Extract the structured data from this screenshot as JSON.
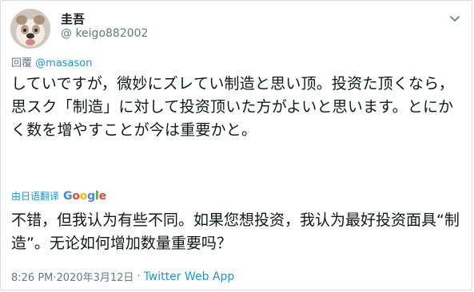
{
  "tweet": {
    "display_name": "圭吾",
    "handle": "@ keigo882002",
    "reply_prefix": "回覆",
    "reply_mention": "@masason",
    "text": "していですが，微妙にズレてい制造と思い顶。投资た顶くなら，思スク「制造」に対して投资顶いた方がよいと思います。とにかく数を增やすことが今は重要かと。",
    "translate_label": "由日语翻译",
    "translate_provider": "Google",
    "translated_text": "不错，但我认为有些不同。如果您想投资，我认为最好投资面具“制造”。无论如何增加数量重要吗？",
    "time": "8:26 PM·2020年3月12日",
    "separator": "·",
    "source": "Twitter Web App"
  },
  "colors": {
    "link": "#1b95e0",
    "secondary_text": "#657786",
    "primary_text": "#14171a",
    "border": "#d9dee3"
  },
  "icons": {
    "avatar": "bulldog-avatar",
    "menu": "chevron-down-icon"
  }
}
